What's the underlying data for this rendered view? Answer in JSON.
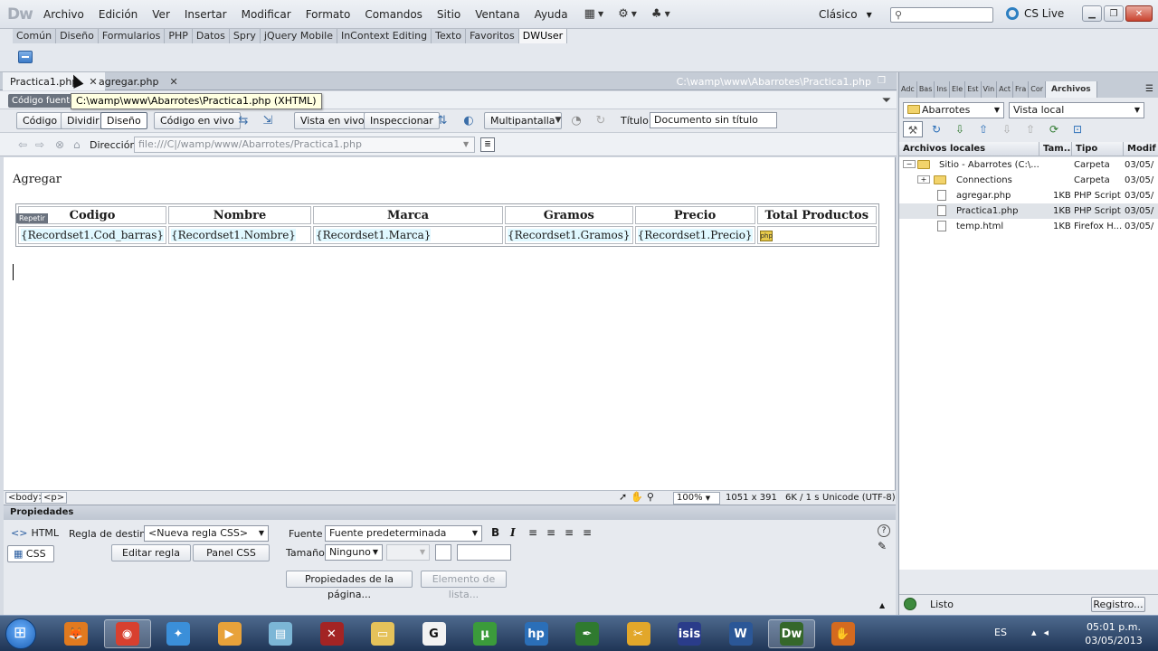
{
  "app": {
    "logo": "Dw",
    "menu": [
      "Archivo",
      "Edición",
      "Ver",
      "Insertar",
      "Modificar",
      "Formato",
      "Comandos",
      "Sitio",
      "Ventana",
      "Ayuda"
    ],
    "workspace": "Clásico",
    "cslive": "CS Live"
  },
  "insert_panel": {
    "tabs": [
      "Común",
      "Diseño",
      "Formularios",
      "PHP",
      "Datos",
      "Spry",
      "jQuery Mobile",
      "InContext Editing",
      "Texto",
      "Favoritos",
      "DWUser"
    ],
    "active_tab": "DWUser"
  },
  "document_tabs": {
    "tabs": [
      {
        "label": "Practica1.php"
      },
      {
        "label": "agregar.php"
      }
    ],
    "file_path": "C:\\wamp\\www\\Abarrotes\\Practica1.php",
    "source_code_label": "Código fuente",
    "tooltip": "C:\\wamp\\www\\Abarrotes\\Practica1.php (XHTML)"
  },
  "doc_toolbar": {
    "codigo": "Código",
    "dividir": "Dividir",
    "diseno": "Diseño",
    "codigo_en_vivo": "Código en vivo",
    "vista_en_vivo": "Vista en vivo",
    "inspeccionar": "Inspeccionar",
    "multipantalla": "Multipantalla",
    "titulo_label": "Título:",
    "titulo_value": "Documento sin título"
  },
  "nav_row": {
    "direccion_label": "Dirección:",
    "direccion_value": "file:///C|/wamp/www/Abarrotes/Practica1.php"
  },
  "design": {
    "heading": "Agregar",
    "repeat_label": "Repetir",
    "table": {
      "headers": [
        "Codigo",
        "Nombre",
        "Marca",
        "Gramos",
        "Precio",
        "Total Productos"
      ],
      "row": [
        "{Recordset1.Cod_barras}",
        "{Recordset1.Nombre}",
        "{Recordset1.Marca}",
        "{Recordset1.Gramos}",
        "{Recordset1.Precio}",
        ""
      ],
      "php_icon": "php"
    }
  },
  "status_bar": {
    "tags": [
      "<body>",
      "<p>"
    ],
    "zoom": "100%",
    "dimensions": "1051 x 391",
    "size": "6K / 1 s",
    "encoding": "Unicode (UTF-8)"
  },
  "properties": {
    "header": "Propiedades",
    "html_label": "HTML",
    "css_label": "CSS",
    "regla_destino_label": "Regla de destino",
    "regla_destino_value": "<Nueva regla CSS>",
    "editar_regla": "Editar regla",
    "panel_css": "Panel CSS",
    "fuente_label": "Fuente",
    "fuente_value": "Fuente predeterminada",
    "tamano_label": "Tamaño",
    "tamano_value": "Ninguno",
    "bold": "B",
    "italic": "I",
    "propiedades_pagina": "Propiedades de la página...",
    "elemento_lista": "Elemento de lista..."
  },
  "files_panel": {
    "tabs": [
      "Adc",
      "Bas",
      "Ins",
      "Ele",
      "Est",
      "Vin",
      "Act",
      "Fra",
      "Cor",
      "Archivos"
    ],
    "site": "Abarrotes",
    "view": "Vista local",
    "columns": [
      "Archivos locales",
      "Tam...",
      "Tipo",
      "Modif"
    ],
    "files": [
      {
        "name": "Sitio - Abarrotes (C:\\...",
        "size": "",
        "type": "Carpeta",
        "modified": "03/05/"
      },
      {
        "name": "Connections",
        "size": "",
        "type": "Carpeta",
        "modified": "03/05/"
      },
      {
        "name": "agregar.php",
        "size": "1KB",
        "type": "PHP Script",
        "modified": "03/05/"
      },
      {
        "name": "Practica1.php",
        "size": "1KB",
        "type": "PHP Script",
        "modified": "03/05/"
      },
      {
        "name": "temp.html",
        "size": "1KB",
        "type": "Firefox H...",
        "modified": "03/05/"
      }
    ],
    "status": "Listo",
    "log_button": "Registro..."
  },
  "taskbar": {
    "apps": [
      {
        "name": "Firefox",
        "glyph": "🦊",
        "color": "#e07a1f"
      },
      {
        "name": "Chrome",
        "glyph": "◉",
        "color": "#d8402f"
      },
      {
        "name": "Safari",
        "glyph": "✦",
        "color": "#3b8fd9"
      },
      {
        "name": "Media",
        "glyph": "▶",
        "color": "#e8a23a"
      },
      {
        "name": "Notes",
        "glyph": "▤",
        "color": "#7cb6d6"
      },
      {
        "name": "Tool",
        "glyph": "✕",
        "color": "#a32424"
      },
      {
        "name": "Folder",
        "glyph": "▭",
        "color": "#e5c25a"
      },
      {
        "name": "G",
        "glyph": "G",
        "color": "#f2f2f2"
      },
      {
        "name": "uTorrent",
        "glyph": "µ",
        "color": "#3b9b3b"
      },
      {
        "name": "HP",
        "glyph": "hp",
        "color": "#2b6fb8"
      },
      {
        "name": "Pen",
        "glyph": "✒",
        "color": "#2f7a2f"
      },
      {
        "name": "Tools",
        "glyph": "✂",
        "color": "#e2a72a"
      },
      {
        "name": "isis",
        "glyph": "isis",
        "color": "#2a3c8a"
      },
      {
        "name": "Word",
        "glyph": "W",
        "color": "#2b5797"
      },
      {
        "name": "Dreamweaver",
        "glyph": "Dw",
        "color": "#35672a"
      },
      {
        "name": "Hand",
        "glyph": "✋",
        "color": "#d46a1f"
      }
    ],
    "lang": "ES",
    "time": "05:01 p.m.",
    "date": "03/05/2013"
  }
}
